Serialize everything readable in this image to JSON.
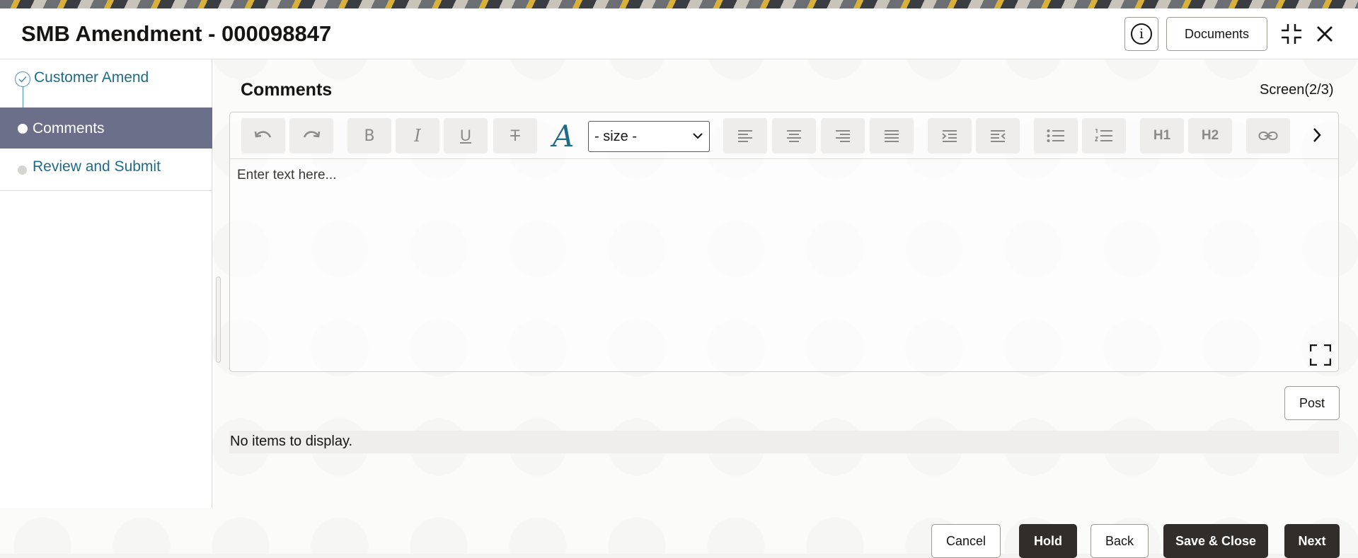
{
  "header": {
    "title": "SMB Amendment - 000098847",
    "documents_label": "Documents",
    "info_icon": "info-icon",
    "minimize_icon": "minimize-icon",
    "close_icon": "close-icon"
  },
  "sidebar": {
    "items": [
      {
        "label": "Customer Amend",
        "state": "completed"
      },
      {
        "label": "Comments",
        "state": "active"
      },
      {
        "label": "Review and Submit",
        "state": "pending"
      }
    ],
    "active_color": "#6b6f8a",
    "link_color": "#1e6c87"
  },
  "main": {
    "title": "Comments",
    "screen_indicator": "Screen(2/3)",
    "editor": {
      "size_select_value": "- size -",
      "placeholder": "Enter text here...",
      "toolbar_icons": [
        "undo-icon",
        "redo-icon",
        "bold-icon",
        "italic-icon",
        "underline-icon",
        "strikethrough-icon",
        "font-color-icon",
        "align-left-icon",
        "align-center-icon",
        "align-right-icon",
        "justify-icon",
        "indent-icon",
        "outdent-icon",
        "bullet-list-icon",
        "numbered-list-icon",
        "heading-1-icon",
        "heading-2-icon",
        "link-icon",
        "chevron-right-icon"
      ],
      "h1_label": "H1",
      "h2_label": "H2"
    },
    "post_label": "Post",
    "empty_message": "No items to display."
  },
  "footer": {
    "cancel_label": "Cancel",
    "hold_label": "Hold",
    "back_label": "Back",
    "save_close_label": "Save & Close",
    "next_label": "Next",
    "primary_color": "#312d2a"
  }
}
